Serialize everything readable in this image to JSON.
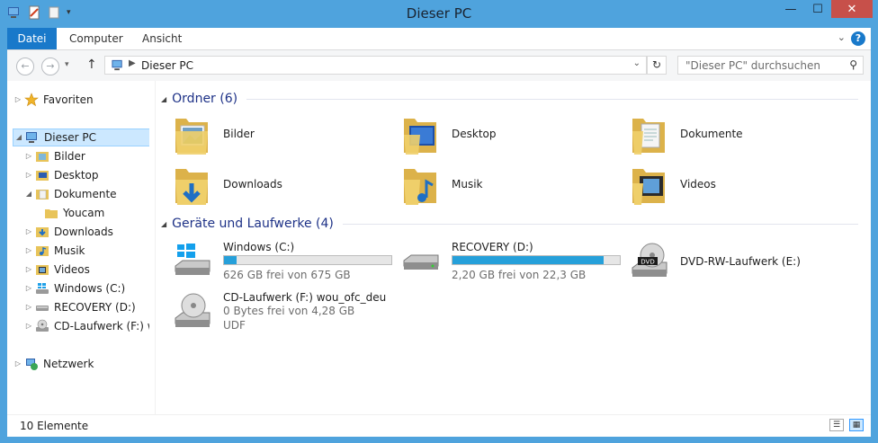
{
  "window": {
    "title": "Dieser PC"
  },
  "ribbon": {
    "tabs": [
      "Datei",
      "Computer",
      "Ansicht"
    ]
  },
  "address": {
    "path": "Dieser PC",
    "search_placeholder": "\"Dieser PC\" durchsuchen"
  },
  "sidebar": {
    "items": [
      {
        "label": "Favoriten"
      },
      {
        "label": "Dieser PC"
      },
      {
        "label": "Bilder"
      },
      {
        "label": "Desktop"
      },
      {
        "label": "Dokumente"
      },
      {
        "label": "Youcam"
      },
      {
        "label": "Downloads"
      },
      {
        "label": "Musik"
      },
      {
        "label": "Videos"
      },
      {
        "label": "Windows (C:)"
      },
      {
        "label": "RECOVERY (D:)"
      },
      {
        "label": "CD-Laufwerk (F:) wou_ofc_deu"
      },
      {
        "label": "Netzwerk"
      }
    ]
  },
  "folders": {
    "header": "Ordner (6)",
    "items": [
      {
        "name": "Bilder"
      },
      {
        "name": "Desktop"
      },
      {
        "name": "Dokumente"
      },
      {
        "name": "Downloads"
      },
      {
        "name": "Musik"
      },
      {
        "name": "Videos"
      }
    ]
  },
  "drives": {
    "header": "Geräte und Laufwerke (4)",
    "items": [
      {
        "name": "Windows (C:)",
        "free": "626 GB frei von 675 GB",
        "used_fraction": 0.073
      },
      {
        "name": "RECOVERY (D:)",
        "free": "2,20 GB frei von 22,3 GB",
        "used_fraction": 0.901
      },
      {
        "name": "DVD-RW-Laufwerk (E:)"
      },
      {
        "name": "CD-Laufwerk (F:) wou_ofc_deu",
        "free": "0 Bytes frei von 4,28 GB",
        "fs": "UDF"
      }
    ]
  },
  "status": {
    "count": "10 Elemente"
  },
  "colors": {
    "accent": "#1979ca",
    "bar_fill": "#26a0da",
    "group_header": "#1e3287",
    "selection": "#cce8ff"
  }
}
